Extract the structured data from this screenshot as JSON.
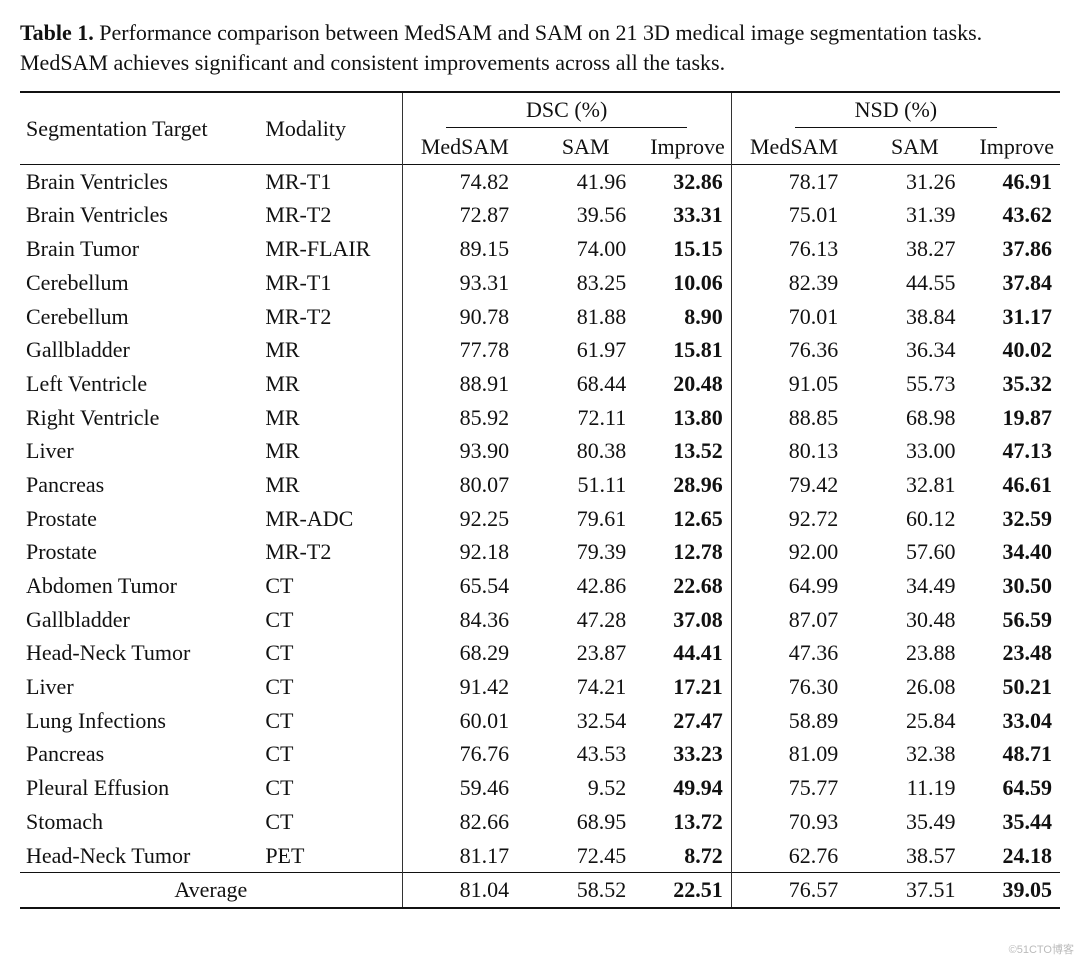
{
  "caption": {
    "lead": "Table 1.",
    "text": " Performance comparison between MedSAM and SAM on 21 3D medical image segmentation tasks. MedSAM achieves significant and consistent improvements across all the tasks."
  },
  "headers": {
    "target": "Segmentation Target",
    "modality": "Modality",
    "dsc_group": "DSC (%)",
    "nsd_group": "NSD (%)",
    "medsam": "MedSAM",
    "sam": "SAM",
    "improve": "Improve"
  },
  "rows": [
    {
      "target": "Brain Ventricles",
      "modality": "MR-T1",
      "dsc_medsam": "74.82",
      "dsc_sam": "41.96",
      "dsc_imp": "32.86",
      "nsd_medsam": "78.17",
      "nsd_sam": "31.26",
      "nsd_imp": "46.91"
    },
    {
      "target": "Brain Ventricles",
      "modality": "MR-T2",
      "dsc_medsam": "72.87",
      "dsc_sam": "39.56",
      "dsc_imp": "33.31",
      "nsd_medsam": "75.01",
      "nsd_sam": "31.39",
      "nsd_imp": "43.62"
    },
    {
      "target": "Brain Tumor",
      "modality": "MR-FLAIR",
      "dsc_medsam": "89.15",
      "dsc_sam": "74.00",
      "dsc_imp": "15.15",
      "nsd_medsam": "76.13",
      "nsd_sam": "38.27",
      "nsd_imp": "37.86"
    },
    {
      "target": "Cerebellum",
      "modality": "MR-T1",
      "dsc_medsam": "93.31",
      "dsc_sam": "83.25",
      "dsc_imp": "10.06",
      "nsd_medsam": "82.39",
      "nsd_sam": "44.55",
      "nsd_imp": "37.84"
    },
    {
      "target": "Cerebellum",
      "modality": "MR-T2",
      "dsc_medsam": "90.78",
      "dsc_sam": "81.88",
      "dsc_imp": "8.90",
      "nsd_medsam": "70.01",
      "nsd_sam": "38.84",
      "nsd_imp": "31.17"
    },
    {
      "target": "Gallbladder",
      "modality": "MR",
      "dsc_medsam": "77.78",
      "dsc_sam": "61.97",
      "dsc_imp": "15.81",
      "nsd_medsam": "76.36",
      "nsd_sam": "36.34",
      "nsd_imp": "40.02"
    },
    {
      "target": "Left Ventricle",
      "modality": "MR",
      "dsc_medsam": "88.91",
      "dsc_sam": "68.44",
      "dsc_imp": "20.48",
      "nsd_medsam": "91.05",
      "nsd_sam": "55.73",
      "nsd_imp": "35.32"
    },
    {
      "target": "Right Ventricle",
      "modality": "MR",
      "dsc_medsam": "85.92",
      "dsc_sam": "72.11",
      "dsc_imp": "13.80",
      "nsd_medsam": "88.85",
      "nsd_sam": "68.98",
      "nsd_imp": "19.87"
    },
    {
      "target": "Liver",
      "modality": "MR",
      "dsc_medsam": "93.90",
      "dsc_sam": "80.38",
      "dsc_imp": "13.52",
      "nsd_medsam": "80.13",
      "nsd_sam": "33.00",
      "nsd_imp": "47.13"
    },
    {
      "target": "Pancreas",
      "modality": "MR",
      "dsc_medsam": "80.07",
      "dsc_sam": "51.11",
      "dsc_imp": "28.96",
      "nsd_medsam": "79.42",
      "nsd_sam": "32.81",
      "nsd_imp": "46.61"
    },
    {
      "target": "Prostate",
      "modality": "MR-ADC",
      "dsc_medsam": "92.25",
      "dsc_sam": "79.61",
      "dsc_imp": "12.65",
      "nsd_medsam": "92.72",
      "nsd_sam": "60.12",
      "nsd_imp": "32.59"
    },
    {
      "target": "Prostate",
      "modality": "MR-T2",
      "dsc_medsam": "92.18",
      "dsc_sam": "79.39",
      "dsc_imp": "12.78",
      "nsd_medsam": "92.00",
      "nsd_sam": "57.60",
      "nsd_imp": "34.40"
    },
    {
      "target": "Abdomen Tumor",
      "modality": "CT",
      "dsc_medsam": "65.54",
      "dsc_sam": "42.86",
      "dsc_imp": "22.68",
      "nsd_medsam": "64.99",
      "nsd_sam": "34.49",
      "nsd_imp": "30.50"
    },
    {
      "target": "Gallbladder",
      "modality": "CT",
      "dsc_medsam": "84.36",
      "dsc_sam": "47.28",
      "dsc_imp": "37.08",
      "nsd_medsam": "87.07",
      "nsd_sam": "30.48",
      "nsd_imp": "56.59"
    },
    {
      "target": "Head-Neck Tumor",
      "modality": "CT",
      "dsc_medsam": "68.29",
      "dsc_sam": "23.87",
      "dsc_imp": "44.41",
      "nsd_medsam": "47.36",
      "nsd_sam": "23.88",
      "nsd_imp": "23.48"
    },
    {
      "target": "Liver",
      "modality": "CT",
      "dsc_medsam": "91.42",
      "dsc_sam": "74.21",
      "dsc_imp": "17.21",
      "nsd_medsam": "76.30",
      "nsd_sam": "26.08",
      "nsd_imp": "50.21"
    },
    {
      "target": "Lung Infections",
      "modality": "CT",
      "dsc_medsam": "60.01",
      "dsc_sam": "32.54",
      "dsc_imp": "27.47",
      "nsd_medsam": "58.89",
      "nsd_sam": "25.84",
      "nsd_imp": "33.04"
    },
    {
      "target": "Pancreas",
      "modality": "CT",
      "dsc_medsam": "76.76",
      "dsc_sam": "43.53",
      "dsc_imp": "33.23",
      "nsd_medsam": "81.09",
      "nsd_sam": "32.38",
      "nsd_imp": "48.71"
    },
    {
      "target": "Pleural Effusion",
      "modality": "CT",
      "dsc_medsam": "59.46",
      "dsc_sam": "9.52",
      "dsc_imp": "49.94",
      "nsd_medsam": "75.77",
      "nsd_sam": "11.19",
      "nsd_imp": "64.59"
    },
    {
      "target": "Stomach",
      "modality": "CT",
      "dsc_medsam": "82.66",
      "dsc_sam": "68.95",
      "dsc_imp": "13.72",
      "nsd_medsam": "70.93",
      "nsd_sam": "35.49",
      "nsd_imp": "35.44"
    },
    {
      "target": "Head-Neck Tumor",
      "modality": "PET",
      "dsc_medsam": "81.17",
      "dsc_sam": "72.45",
      "dsc_imp": "8.72",
      "nsd_medsam": "62.76",
      "nsd_sam": "38.57",
      "nsd_imp": "24.18"
    }
  ],
  "average": {
    "label": "Average",
    "dsc_medsam": "81.04",
    "dsc_sam": "58.52",
    "dsc_imp": "22.51",
    "nsd_medsam": "76.57",
    "nsd_sam": "37.51",
    "nsd_imp": "39.05"
  },
  "watermark": "©51CTO博客"
}
